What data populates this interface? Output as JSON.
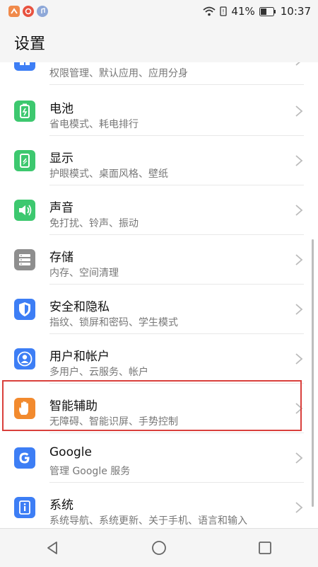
{
  "status_bar": {
    "battery": "41%",
    "time": "10:37"
  },
  "header": {
    "title": "设置"
  },
  "colors": {
    "green": "#3dc86f",
    "gray": "#8e8e8e",
    "blue": "#3d7ef5",
    "orange": "#f28a2e",
    "highlight": "#d9403c"
  },
  "settings": {
    "items": [
      {
        "title": "",
        "subtitle": "权限管理、默认应用、应用分身",
        "icon": "apps-icon",
        "color": "#3d7ef5"
      },
      {
        "title": "电池",
        "subtitle": "省电模式、耗电排行",
        "icon": "battery-icon",
        "color": "#3dc86f"
      },
      {
        "title": "显示",
        "subtitle": "护眼模式、桌面风格、壁纸",
        "icon": "display-icon",
        "color": "#3dc86f"
      },
      {
        "title": "声音",
        "subtitle": "免打扰、铃声、振动",
        "icon": "sound-icon",
        "color": "#3dc86f"
      },
      {
        "title": "存储",
        "subtitle": "内存、空间清理",
        "icon": "storage-icon",
        "color": "#8e8e8e"
      },
      {
        "title": "安全和隐私",
        "subtitle": "指纹、锁屏和密码、学生模式",
        "icon": "shield-icon",
        "color": "#3d7ef5"
      },
      {
        "title": "用户和帐户",
        "subtitle": "多用户、云服务、帐户",
        "icon": "user-icon",
        "color": "#3d7ef5"
      },
      {
        "title": "智能辅助",
        "subtitle": "无障碍、智能识屏、手势控制",
        "icon": "hand-icon",
        "color": "#f28a2e"
      },
      {
        "title": "Google",
        "subtitle": "管理 Google 服务",
        "icon": "google-icon",
        "color": "#3d7ef5"
      },
      {
        "title": "系统",
        "subtitle": "系统导航、系统更新、关于手机、语言和输入",
        "icon": "info-icon",
        "color": "#3d7ef5"
      }
    ]
  }
}
